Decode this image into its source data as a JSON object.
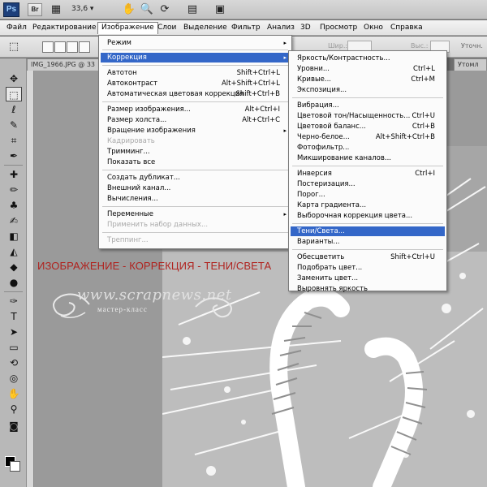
{
  "appbar": {
    "logo": "Ps",
    "br_label": "Br",
    "zoom": "33,6",
    "zoom_arrow": "▾"
  },
  "menubar": {
    "items": [
      "Файл",
      "Редактирование",
      "Изображение",
      "Слои",
      "Выделение",
      "Фильтр",
      "Анализ",
      "3D",
      "Просмотр",
      "Окно",
      "Справка"
    ]
  },
  "optbar": {
    "width_label": "Шир.:",
    "height_label": "Выс.:",
    "refine_label": "Уточн."
  },
  "document": {
    "tab_title": "IMG_1966.JPG @ 33",
    "tab2_title": "Утомл"
  },
  "menu_image": {
    "items": [
      {
        "label": "Режим",
        "shortcut": "",
        "arrow": "▸",
        "state": "normal"
      },
      {
        "label": "Коррекция",
        "shortcut": "",
        "arrow": "▸",
        "state": "highlight"
      },
      {
        "label": "Автотон",
        "shortcut": "Shift+Ctrl+L",
        "arrow": "",
        "state": "normal"
      },
      {
        "label": "Автоконтраст",
        "shortcut": "Alt+Shift+Ctrl+L",
        "arrow": "",
        "state": "normal"
      },
      {
        "label": "Автоматическая цветовая коррекция",
        "shortcut": "Shift+Ctrl+B",
        "arrow": "",
        "state": "normal"
      },
      {
        "label": "Размер изображения...",
        "shortcut": "Alt+Ctrl+I",
        "arrow": "",
        "state": "normal"
      },
      {
        "label": "Размер холста...",
        "shortcut": "Alt+Ctrl+C",
        "arrow": "",
        "state": "normal"
      },
      {
        "label": "Вращение изображения",
        "shortcut": "",
        "arrow": "▸",
        "state": "normal"
      },
      {
        "label": "Кадрировать",
        "shortcut": "",
        "arrow": "",
        "state": "disabled"
      },
      {
        "label": "Тримминг...",
        "shortcut": "",
        "arrow": "",
        "state": "normal"
      },
      {
        "label": "Показать все",
        "shortcut": "",
        "arrow": "",
        "state": "normal"
      },
      {
        "label": "Создать дубликат...",
        "shortcut": "",
        "arrow": "",
        "state": "normal"
      },
      {
        "label": "Внешний канал...",
        "shortcut": "",
        "arrow": "",
        "state": "normal"
      },
      {
        "label": "Вычисления...",
        "shortcut": "",
        "arrow": "",
        "state": "normal"
      },
      {
        "label": "Переменные",
        "shortcut": "",
        "arrow": "▸",
        "state": "normal"
      },
      {
        "label": "Применить набор данных...",
        "shortcut": "",
        "arrow": "",
        "state": "disabled"
      },
      {
        "label": "Треппинг...",
        "shortcut": "",
        "arrow": "",
        "state": "disabled"
      }
    ]
  },
  "menu_correction": {
    "items": [
      {
        "label": "Яркость/Контрастность...",
        "shortcut": "",
        "state": "normal"
      },
      {
        "label": "Уровни...",
        "shortcut": "Ctrl+L",
        "state": "normal"
      },
      {
        "label": "Кривые...",
        "shortcut": "Ctrl+M",
        "state": "normal"
      },
      {
        "label": "Экспозиция...",
        "shortcut": "",
        "state": "normal"
      },
      {
        "label": "Вибрация...",
        "shortcut": "",
        "state": "normal"
      },
      {
        "label": "Цветовой тон/Насыщенность...",
        "shortcut": "Ctrl+U",
        "state": "normal"
      },
      {
        "label": "Цветовой баланс...",
        "shortcut": "Ctrl+B",
        "state": "normal"
      },
      {
        "label": "Черно-белое...",
        "shortcut": "Alt+Shift+Ctrl+B",
        "state": "normal"
      },
      {
        "label": "Фотофильтр...",
        "shortcut": "",
        "state": "normal"
      },
      {
        "label": "Микширование каналов...",
        "shortcut": "",
        "state": "normal"
      },
      {
        "label": "Инверсия",
        "shortcut": "Ctrl+I",
        "state": "normal"
      },
      {
        "label": "Постеризация...",
        "shortcut": "",
        "state": "normal"
      },
      {
        "label": "Порог...",
        "shortcut": "",
        "state": "normal"
      },
      {
        "label": "Карта градиента...",
        "shortcut": "",
        "state": "normal"
      },
      {
        "label": "Выборочная коррекция цвета...",
        "shortcut": "",
        "state": "normal"
      },
      {
        "label": "Тени/Света...",
        "shortcut": "",
        "state": "highlight"
      },
      {
        "label": "Варианты...",
        "shortcut": "",
        "state": "normal"
      },
      {
        "label": "Обесцветить",
        "shortcut": "Shift+Ctrl+U",
        "state": "normal"
      },
      {
        "label": "Подобрать цвет...",
        "shortcut": "",
        "state": "normal"
      },
      {
        "label": "Заменить цвет...",
        "shortcut": "",
        "state": "normal"
      },
      {
        "label": "Выровнять яркость",
        "shortcut": "",
        "state": "normal"
      }
    ]
  },
  "caption": "ИЗОБРАЖЕНИЕ - КОРРЕКЦИЯ - ТЕНИ/СВЕТА",
  "watermark": {
    "site": "www.scrapnews.net",
    "subtitle": "мастер-класс"
  },
  "colors": {
    "menu_highlight": "#3467c8",
    "caption": "#b0231f"
  }
}
